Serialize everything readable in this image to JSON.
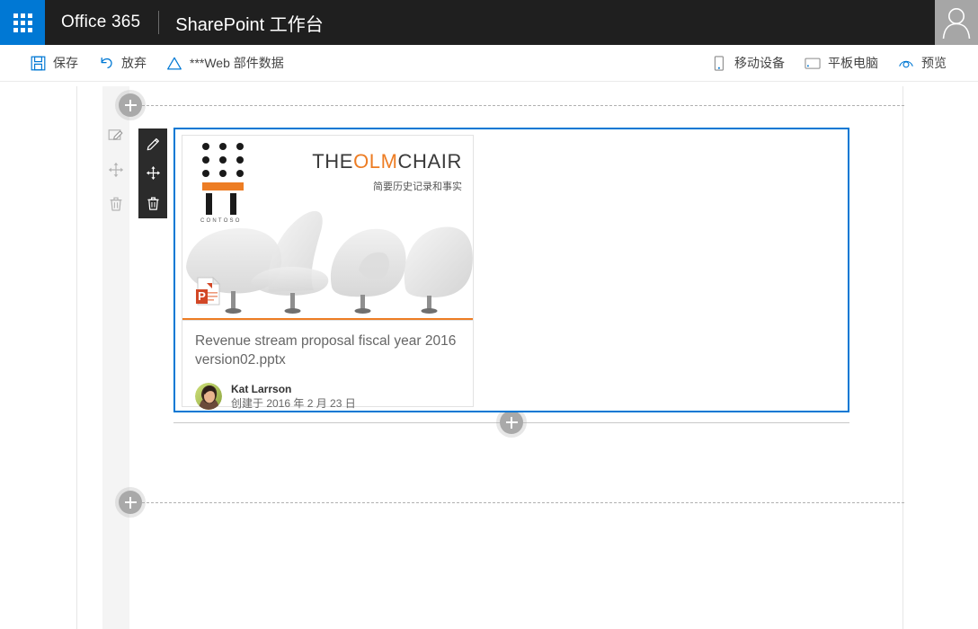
{
  "header": {
    "waffle_icon": "app-launcher-waffle-icon",
    "brand": "Office 365",
    "title": "SharePoint 工作台",
    "avatar_icon": "user-silhouette-icon"
  },
  "toolbar": {
    "left": [
      {
        "icon": "save-floppy-icon",
        "label": "保存"
      },
      {
        "icon": "undo-arrow-icon",
        "label": "放弃"
      },
      {
        "icon": "triangle-warning-icon",
        "label": "***Web 部件数据"
      }
    ],
    "right": [
      {
        "icon": "mobile-phone-icon",
        "label": "移动设备"
      },
      {
        "icon": "tablet-icon",
        "label": "平板电脑"
      },
      {
        "icon": "preview-eye-icon",
        "label": "预览"
      }
    ]
  },
  "canvas": {
    "rail_icons": [
      {
        "icon": "edit-page-icon",
        "name": "edit-section-button"
      },
      {
        "icon": "move-arrows-icon",
        "name": "move-section-button"
      },
      {
        "icon": "trash-icon",
        "name": "delete-section-button"
      }
    ],
    "add_buttons": [
      {
        "name": "add-section-top-button",
        "icon": "plus-icon"
      },
      {
        "name": "add-webpart-below-button",
        "icon": "plus-icon"
      },
      {
        "name": "add-section-bottom-button",
        "icon": "plus-icon"
      }
    ],
    "webpart_toolbar": [
      {
        "icon": "pencil-edit-icon",
        "name": "edit-webpart-button"
      },
      {
        "icon": "move-arrows-icon",
        "name": "move-webpart-button"
      },
      {
        "icon": "trash-icon",
        "name": "delete-webpart-button"
      }
    ]
  },
  "card": {
    "slide": {
      "logo_word": "CONTOSO",
      "title_part1": "THE",
      "title_part2": "OLM",
      "title_part3": "CHAIR",
      "subtitle": "简要历史记录和事实"
    },
    "file_icon": "powerpoint-file-icon",
    "title": "Revenue stream proposal fiscal year 2016 version02.pptx",
    "author": "Kat Larrson",
    "created": "创建于 2016 年 2 月 23 日",
    "avatar_icon": "person-photo-avatar"
  },
  "colors": {
    "accent_blue": "#0078d4",
    "header_dark": "#1f1f1f",
    "brand_orange": "#ed7d24",
    "toolbar_dark": "#2b2b2b"
  }
}
